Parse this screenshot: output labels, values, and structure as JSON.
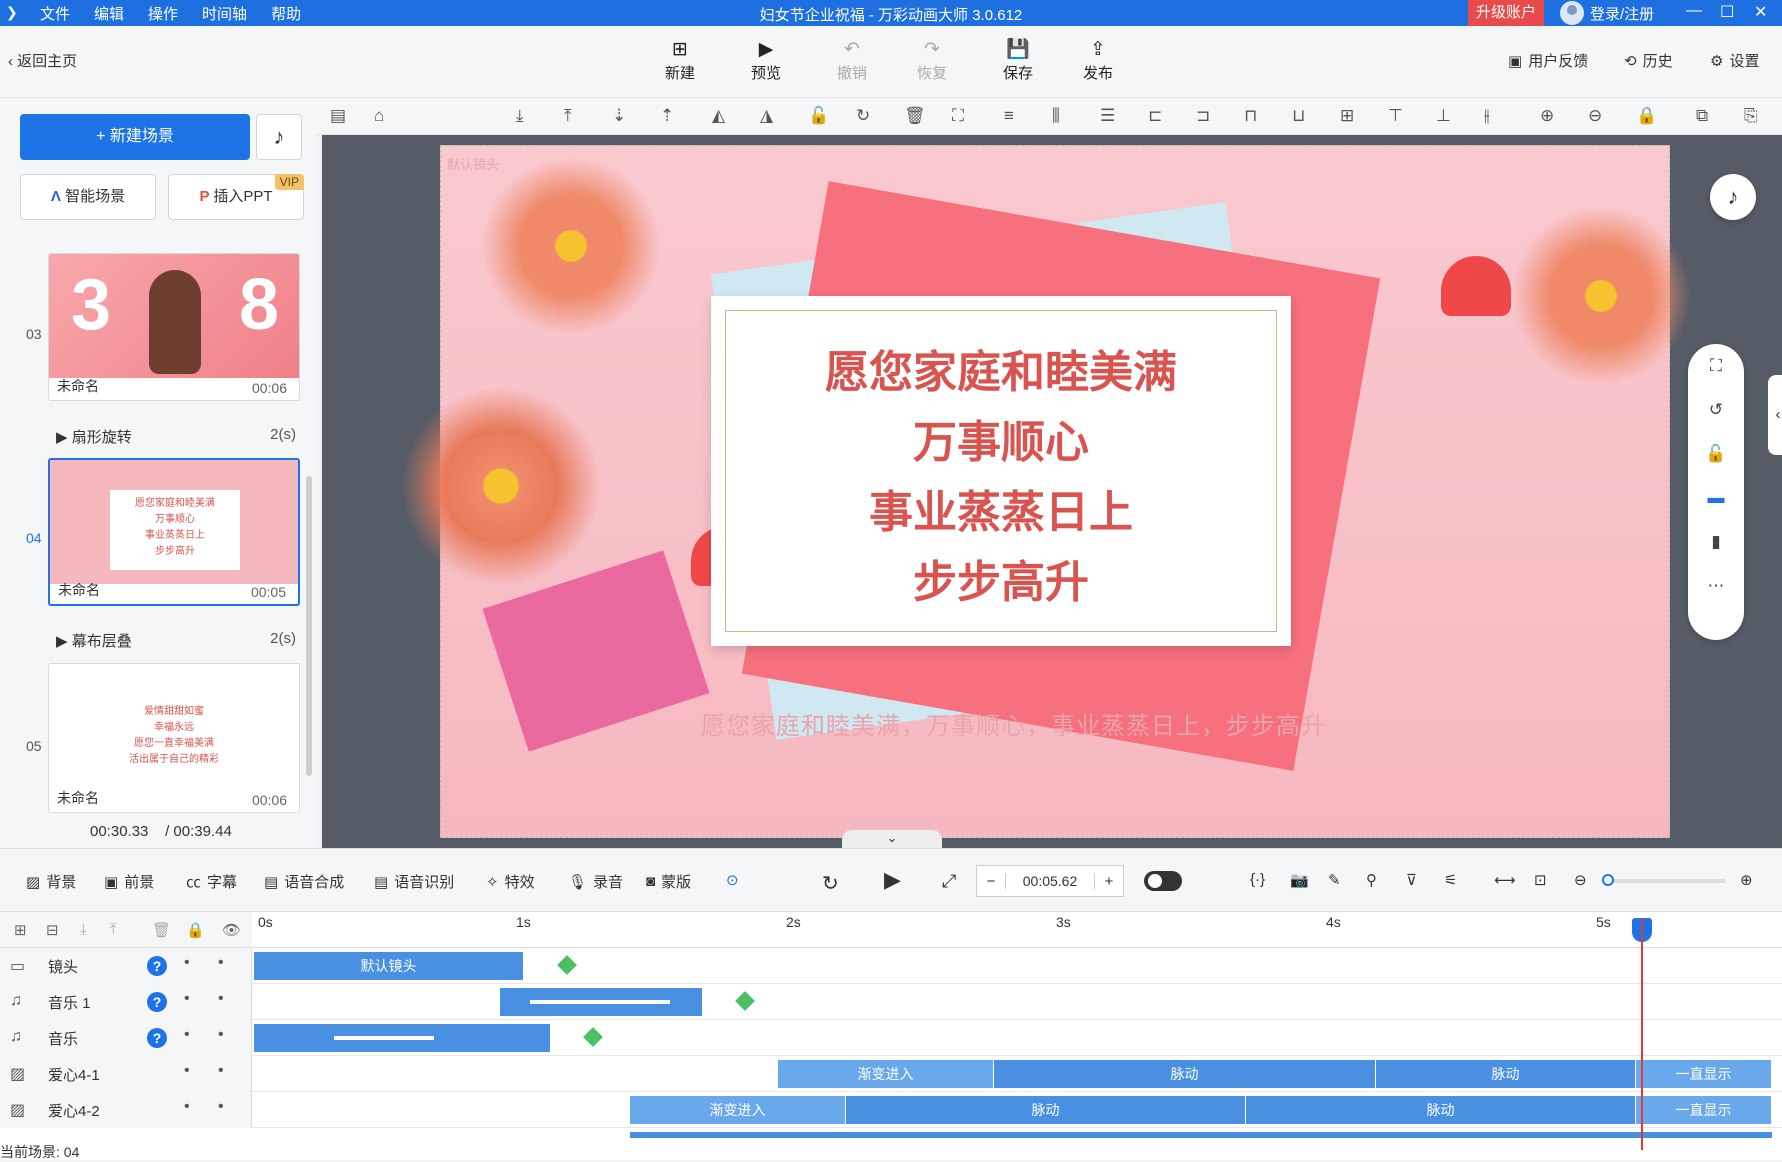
{
  "titlebar": {
    "menu": [
      "文件",
      "编辑",
      "操作",
      "时间轴",
      "帮助"
    ],
    "title": "妇女节企业祝福 - 万彩动画大师 3.0.612",
    "upgrade": "升级账户",
    "login": "登录/注册"
  },
  "topbar": {
    "back": "返回主页",
    "buttons": [
      {
        "label": "新建",
        "icon": "plus-square-icon",
        "enabled": true
      },
      {
        "label": "预览",
        "icon": "play-icon",
        "enabled": true
      },
      {
        "label": "撤销",
        "icon": "undo-icon",
        "enabled": false
      },
      {
        "label": "恢复",
        "icon": "redo-icon",
        "enabled": false
      },
      {
        "label": "保存",
        "icon": "save-icon",
        "enabled": true
      },
      {
        "label": "发布",
        "icon": "publish-icon",
        "enabled": true
      }
    ],
    "feedback": "用户反馈",
    "history": "历史",
    "settings": "设置"
  },
  "left": {
    "new_scene": "+ 新建场景",
    "smart_scene": "智能场景",
    "insert_ppt": "插入PPT",
    "vip": "VIP",
    "scenes": [
      {
        "num": "03",
        "name": "未命名",
        "duration": "00:06",
        "selected": false
      },
      {
        "num": "04",
        "name": "未命名",
        "duration": "00:05",
        "selected": true
      },
      {
        "num": "05",
        "name": "未命名",
        "duration": "00:06",
        "selected": false
      }
    ],
    "transitions": [
      {
        "name": "扇形旋转",
        "duration": "2(s)"
      },
      {
        "name": "幕布层叠",
        "duration": "2(s)"
      }
    ],
    "current_time": "00:30.33",
    "total_time": "/ 00:39.44",
    "thumb3_text": [
      "3",
      "8"
    ],
    "thumb4_lines": [
      "愿您家庭和睦美满",
      "万事顺心",
      "事业蒸蒸日上",
      "步步高升"
    ],
    "thumb5_lines": [
      "爱情甜甜如蜜",
      "幸福永远",
      "愿您一直幸福美满",
      "活出属于自己的精彩"
    ]
  },
  "canvas": {
    "camera_label": "默认镜头",
    "lines": [
      "愿您家庭和睦美满",
      "万事顺心",
      "事业蒸蒸日上",
      "步步高升"
    ],
    "subtitle": "愿您家庭和睦美满，万事顺心，事业蒸蒸日上，步步高升"
  },
  "toolrow": {
    "items": [
      "背景",
      "前景",
      "字幕",
      "语音合成",
      "语音识别",
      "特效",
      "录音",
      "蒙版"
    ],
    "time": "00:05.62"
  },
  "timeline": {
    "ruler": [
      "0s",
      "1s",
      "2s",
      "3s",
      "4s",
      "5s"
    ],
    "tracks": [
      {
        "name": "镜头",
        "icon": "camera-icon",
        "help": true
      },
      {
        "name": "音乐 1",
        "icon": "music-note-icon",
        "help": true
      },
      {
        "name": "音乐",
        "icon": "music-note-icon",
        "help": true
      },
      {
        "name": "爱心4-1",
        "icon": "image-icon",
        "help": false
      },
      {
        "name": "爱心4-2",
        "icon": "image-icon",
        "help": false
      }
    ],
    "segments": {
      "camera": "默认镜头",
      "heart1": [
        "渐变进入",
        "脉动",
        "脉动",
        "一直显示"
      ],
      "heart2": [
        "渐变进入",
        "脉动",
        "脉动",
        "一直显示"
      ]
    },
    "help_glyph": "?",
    "dot_glyph": "•"
  },
  "status": "当前场景: 04",
  "colors": {
    "accent": "#1e74e6",
    "titlebar": "#1e6fe0",
    "upgrade": "#e84b4b",
    "card_text": "#d9534f"
  }
}
